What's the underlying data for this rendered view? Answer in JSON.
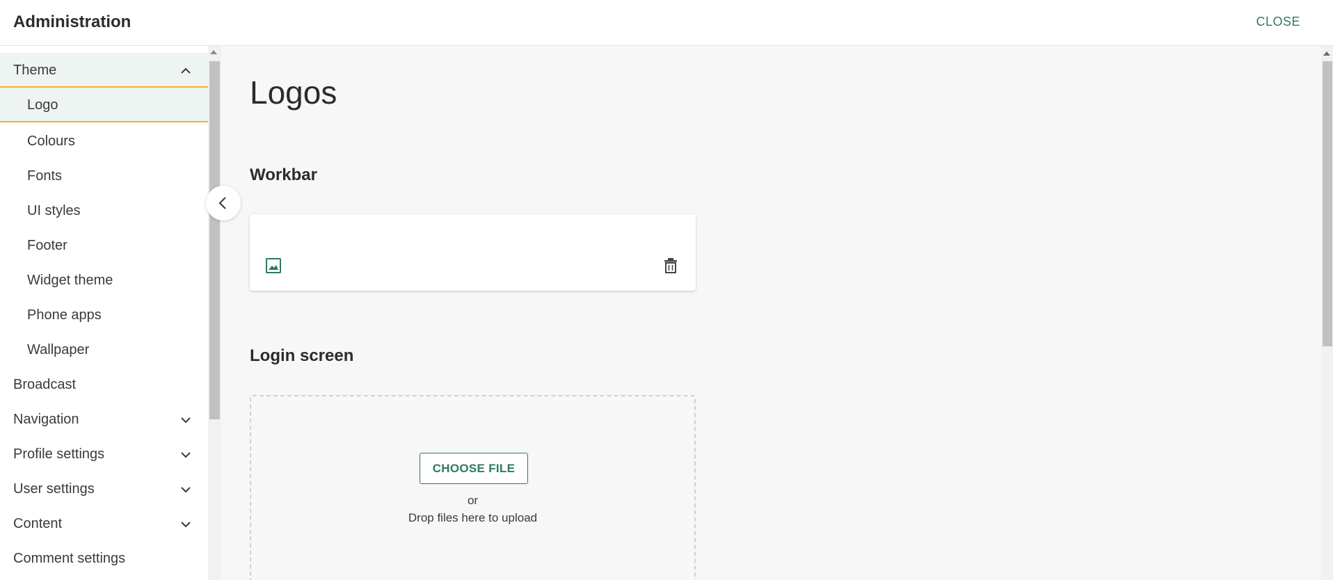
{
  "header": {
    "title": "Administration",
    "close_label": "CLOSE"
  },
  "sidebar": {
    "items": [
      {
        "label": "Theme",
        "expanded": true,
        "chevron": "chevron-up-icon"
      },
      {
        "label": "Logo",
        "sub": true,
        "active": true
      },
      {
        "label": "Colours",
        "sub": true
      },
      {
        "label": "Fonts",
        "sub": true
      },
      {
        "label": "UI styles",
        "sub": true
      },
      {
        "label": "Footer",
        "sub": true
      },
      {
        "label": "Widget theme",
        "sub": true
      },
      {
        "label": "Phone apps",
        "sub": true
      },
      {
        "label": "Wallpaper",
        "sub": true
      },
      {
        "label": "Broadcast"
      },
      {
        "label": "Navigation",
        "chevron": "chevron-down-icon"
      },
      {
        "label": "Profile settings",
        "chevron": "chevron-down-icon"
      },
      {
        "label": "User settings",
        "chevron": "chevron-down-icon"
      },
      {
        "label": "Content",
        "chevron": "chevron-down-icon"
      },
      {
        "label": "Comment settings"
      }
    ]
  },
  "main": {
    "page_title": "Logos",
    "workbar": {
      "title": "Workbar",
      "image_icon": "image-icon",
      "delete_icon": "trash-icon"
    },
    "login_screen": {
      "title": "Login screen",
      "choose_file_label": "CHOOSE FILE",
      "or_text": "or",
      "drop_text": "Drop files here to upload"
    }
  },
  "colors": {
    "accent": "#2d7a5c",
    "highlight_border": "#f0b429",
    "active_bg": "#eef4f1",
    "main_bg": "#f7f7f7"
  }
}
